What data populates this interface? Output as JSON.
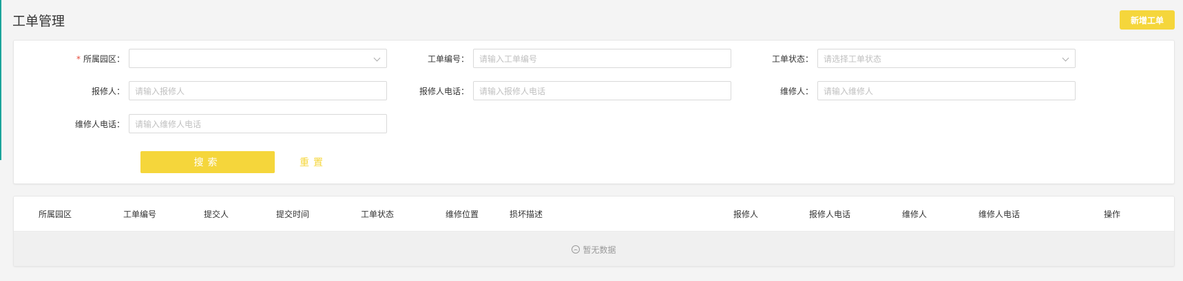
{
  "header": {
    "title": "工单管理",
    "add_label": "新增工单"
  },
  "filters": {
    "park": {
      "label": "所属园区：",
      "required": "*",
      "placeholder": ""
    },
    "order_no": {
      "label": "工单编号：",
      "placeholder": "请输入工单编号"
    },
    "status": {
      "label": "工单状态：",
      "placeholder": "请选择工单状态"
    },
    "reporter": {
      "label": "报修人：",
      "placeholder": "请输入报修人"
    },
    "reporter_phone": {
      "label": "报修人电话：",
      "placeholder": "请输入报修人电话"
    },
    "repairer": {
      "label": "维修人：",
      "placeholder": "请输入维修人"
    },
    "repairer_phone": {
      "label": "维修人电话：",
      "placeholder": "请输入维修人电话"
    },
    "search_label": "搜索",
    "reset_label": "重置"
  },
  "table": {
    "columns": [
      "所属园区",
      "工单编号",
      "提交人",
      "提交时间",
      "工单状态",
      "维修位置",
      "损坏描述",
      "报修人",
      "报修人电话",
      "维修人",
      "维修人电话",
      "操作"
    ],
    "empty_text": "暂无数据"
  },
  "colors": {
    "accent": "#f5d63b",
    "required": "#e54a3b",
    "side_accent": "#1aa39a"
  }
}
